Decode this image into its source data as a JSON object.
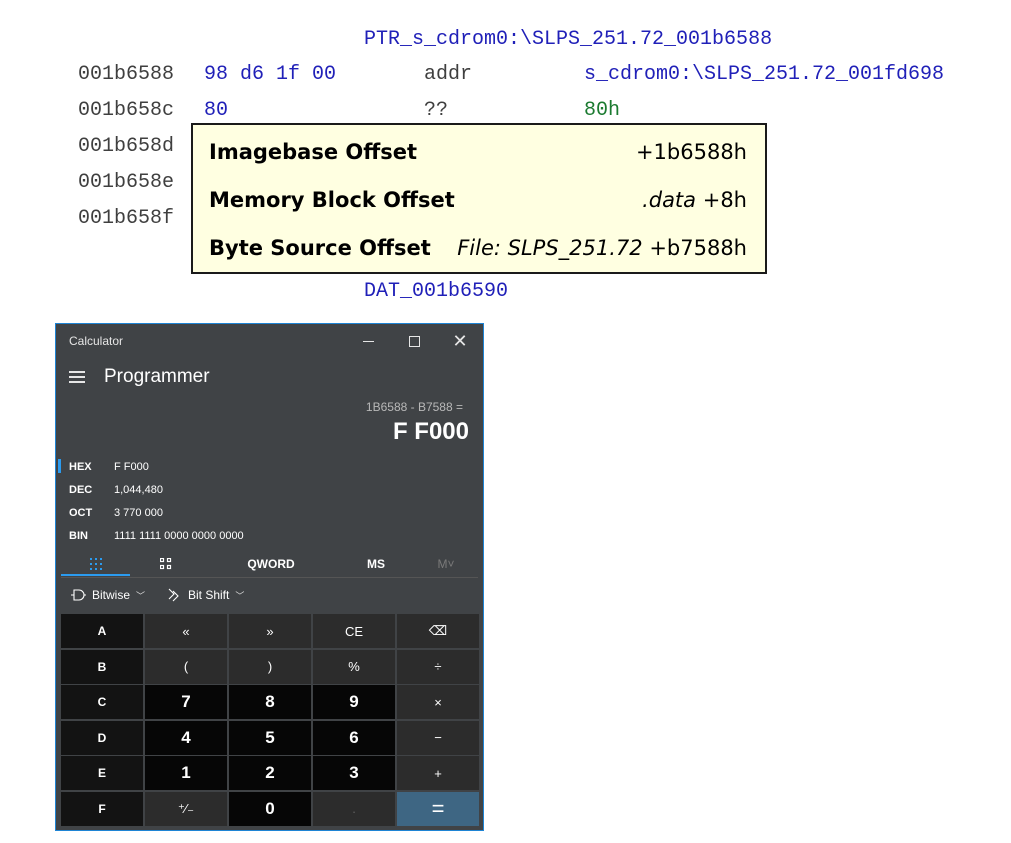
{
  "listing": {
    "ptr_label": "PTR_s_cdrom0:\\SLPS_251.72_001b6588",
    "rows": [
      {
        "addr": "001b6588",
        "bytes": "98 d6 1f 00",
        "mnemonic": "addr",
        "operand": "s_cdrom0:\\SLPS_251.72_001fd698"
      },
      {
        "addr": "001b658c",
        "bytes": "80",
        "mnemonic": "??",
        "operand": "80h"
      },
      {
        "addr": "001b658d"
      },
      {
        "addr": "001b658e"
      },
      {
        "addr": "001b658f"
      }
    ],
    "dat_label": "DAT_001b6590"
  },
  "tooltip": {
    "rows": [
      {
        "label": "Imagebase Offset",
        "value_italic": "",
        "value": "+1b6588h"
      },
      {
        "label": "Memory Block Offset",
        "value_italic": ".data",
        "value": " +8h"
      },
      {
        "label": "Byte Source Offset",
        "value_italic": "File: SLPS_251.72",
        "value": " +b7588h"
      }
    ]
  },
  "calculator": {
    "window_title": "Calculator",
    "mode": "Programmer",
    "expression": "1B6588 - B7588 =",
    "result": "F F000",
    "radix": [
      {
        "name": "HEX",
        "value": "F F000",
        "selected": true
      },
      {
        "name": "DEC",
        "value": "1,044,480"
      },
      {
        "name": "OCT",
        "value": "3 770 000"
      },
      {
        "name": "BIN",
        "value": "1111 1111 0000 0000 0000"
      }
    ],
    "tabs": {
      "word_size": "QWORD",
      "ms": "MS",
      "m_dropdown": "M˅"
    },
    "bitbar": {
      "bitwise": "Bitwise",
      "bitshift": "Bit Shift"
    },
    "keys": [
      [
        "A",
        "«",
        "»",
        "CE",
        "⌫"
      ],
      [
        "B",
        "(",
        ")",
        "%",
        "÷"
      ],
      [
        "C",
        "7",
        "8",
        "9",
        "×"
      ],
      [
        "D",
        "4",
        "5",
        "6",
        "−"
      ],
      [
        "E",
        "1",
        "2",
        "3",
        "+"
      ],
      [
        "F",
        "⁺⁄₋",
        "0",
        ".",
        "="
      ]
    ]
  }
}
